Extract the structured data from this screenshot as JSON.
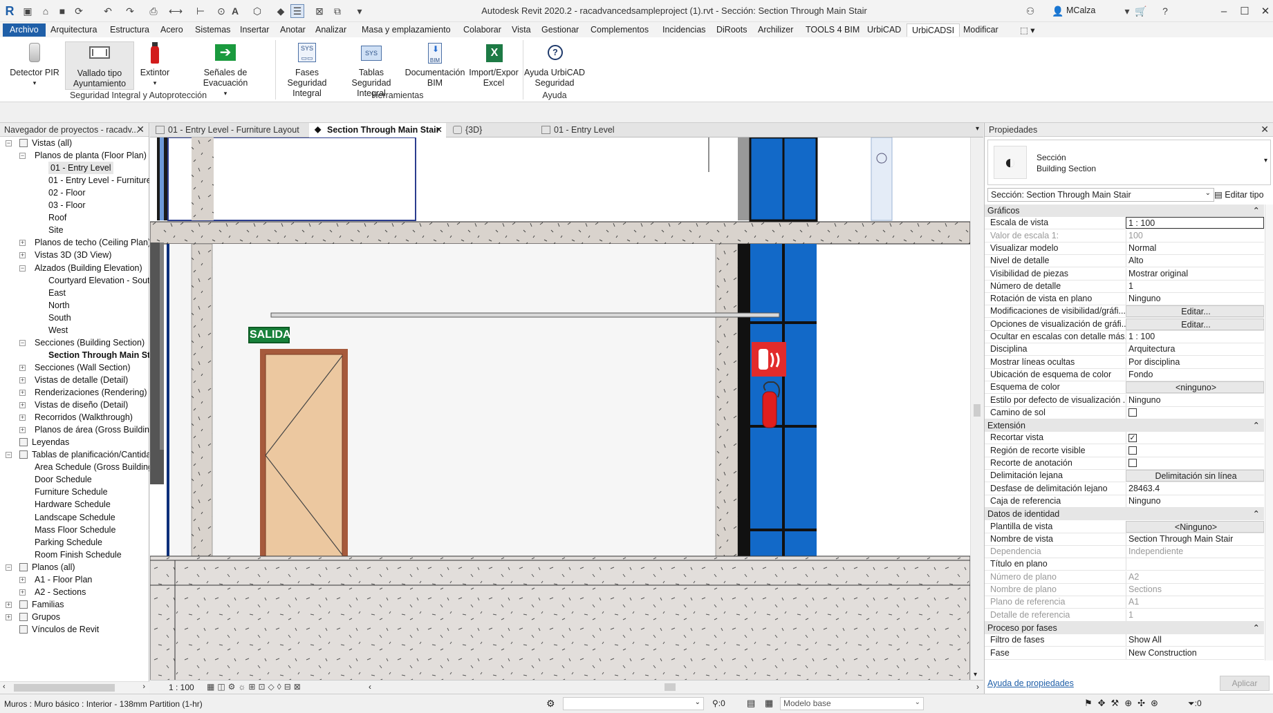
{
  "window": {
    "title": "Autodesk Revit 2020.2 - racadvancedsampleproject (1).rvt - Sección: Section Through Main Stair",
    "user": "MCalza"
  },
  "ribbon": {
    "tabs": [
      "Archivo",
      "Arquitectura",
      "Estructura",
      "Acero",
      "Sistemas",
      "Insertar",
      "Anotar",
      "Analizar",
      "Masa y emplazamiento",
      "Colaborar",
      "Vista",
      "Gestionar",
      "Complementos",
      "Incidencias",
      "DiRoots",
      "Archilizer",
      "TOOLS 4 BIM",
      "UrbiCAD",
      "UrbiCADSI",
      "Modificar"
    ],
    "active_tab": "UrbiCADSI",
    "buttons": [
      {
        "l1": "Detector PIR",
        "l2": ""
      },
      {
        "l1": "Vallado tipo",
        "l2": "Ayuntamiento"
      },
      {
        "l1": "Extintor",
        "l2": ""
      },
      {
        "l1": "Señales de Evacuación",
        "l2": ""
      },
      {
        "l1": "Fases Seguridad",
        "l2": "Integral"
      },
      {
        "l1": "Tablas Seguridad",
        "l2": "Integral"
      },
      {
        "l1": "Documentación",
        "l2": "BIM"
      },
      {
        "l1": "Import/Expor",
        "l2": "Excel"
      },
      {
        "l1": "Ayuda UrbiCAD",
        "l2": "Seguridad"
      }
    ],
    "groups": [
      "Seguridad Integral y Autoprotección",
      "Herramientas",
      "Ayuda"
    ]
  },
  "browser": {
    "title": "Navegador de proyectos - racadv...",
    "items": [
      {
        "t": "Vistas (all)",
        "d": 0,
        "tog": "-"
      },
      {
        "t": "Planos de planta (Floor Plan)",
        "d": 1,
        "tog": "-"
      },
      {
        "t": "01 - Entry Level",
        "d": 2,
        "sel": true
      },
      {
        "t": "01 - Entry Level - Furniture",
        "d": 2
      },
      {
        "t": "02 - Floor",
        "d": 2
      },
      {
        "t": "03 - Floor",
        "d": 2
      },
      {
        "t": "Roof",
        "d": 2
      },
      {
        "t": "Site",
        "d": 2
      },
      {
        "t": "Planos de techo (Ceiling Plan)",
        "d": 1,
        "tog": "+"
      },
      {
        "t": "Vistas 3D (3D View)",
        "d": 1,
        "tog": "+"
      },
      {
        "t": "Alzados (Building Elevation)",
        "d": 1,
        "tog": "-"
      },
      {
        "t": "Courtyard Elevation - South",
        "d": 2
      },
      {
        "t": "East",
        "d": 2
      },
      {
        "t": "North",
        "d": 2
      },
      {
        "t": "South",
        "d": 2
      },
      {
        "t": "West",
        "d": 2
      },
      {
        "t": "Secciones (Building Section)",
        "d": 1,
        "tog": "-"
      },
      {
        "t": "Section Through Main Sta",
        "d": 2,
        "bold": true
      },
      {
        "t": "Secciones (Wall Section)",
        "d": 1,
        "tog": "+"
      },
      {
        "t": "Vistas de detalle (Detail)",
        "d": 1,
        "tog": "+"
      },
      {
        "t": "Renderizaciones (Rendering)",
        "d": 1,
        "tog": "+"
      },
      {
        "t": "Vistas de diseño (Detail)",
        "d": 1,
        "tog": "+"
      },
      {
        "t": "Recorridos (Walkthrough)",
        "d": 1,
        "tog": "+"
      },
      {
        "t": "Planos de área (Gross Building",
        "d": 1,
        "tog": "+"
      },
      {
        "t": "Leyendas",
        "d": 0
      },
      {
        "t": "Tablas de planificación/Cantidad",
        "d": 0,
        "tog": "-"
      },
      {
        "t": "Area Schedule (Gross Building",
        "d": 1
      },
      {
        "t": "Door Schedule",
        "d": 1
      },
      {
        "t": "Furniture Schedule",
        "d": 1
      },
      {
        "t": "Hardware Schedule",
        "d": 1
      },
      {
        "t": "Landscape Schedule",
        "d": 1
      },
      {
        "t": "Mass Floor Schedule",
        "d": 1
      },
      {
        "t": "Parking Schedule",
        "d": 1
      },
      {
        "t": "Room Finish Schedule",
        "d": 1
      },
      {
        "t": "Planos (all)",
        "d": 0,
        "tog": "-"
      },
      {
        "t": "A1 - Floor Plan",
        "d": 1,
        "tog": "+"
      },
      {
        "t": "A2 - Sections",
        "d": 1,
        "tog": "+"
      },
      {
        "t": "Familias",
        "d": 0,
        "tog": "+"
      },
      {
        "t": "Grupos",
        "d": 0,
        "tog": "+"
      },
      {
        "t": "Vínculos de Revit",
        "d": 0
      }
    ]
  },
  "view_tabs": [
    {
      "label": "01 - Entry Level - Furniture Layout",
      "active": false
    },
    {
      "label": "Section Through Main Stair",
      "active": true
    },
    {
      "label": "{3D}",
      "active": false
    },
    {
      "label": "01 - Entry Level",
      "active": false
    }
  ],
  "canvas": {
    "exit_sign": "SALIDA"
  },
  "view_control": {
    "scale": "1 : 100"
  },
  "properties": {
    "title": "Propiedades",
    "family": "Sección",
    "type": "Building Section",
    "selector": "Sección: Section Through Main Stair",
    "edit_type": "Editar tipo",
    "help": "Ayuda de propiedades",
    "apply": "Aplicar",
    "sections": [
      {
        "name": "Gráficos",
        "rows": [
          {
            "k": "Escala de vista",
            "v": "1 : 100",
            "kind": "input"
          },
          {
            "k": "Valor de escala    1:",
            "v": "100",
            "dis": true
          },
          {
            "k": "Visualizar modelo",
            "v": "Normal"
          },
          {
            "k": "Nivel de detalle",
            "v": "Alto"
          },
          {
            "k": "Visibilidad de piezas",
            "v": "Mostrar original"
          },
          {
            "k": "Número de detalle",
            "v": "1"
          },
          {
            "k": "Rotación de vista en plano",
            "v": "Ninguno"
          },
          {
            "k": "Modificaciones de visibilidad/gráfi...",
            "v": "Editar...",
            "kind": "btn"
          },
          {
            "k": "Opciones de visualización de gráfi...",
            "v": "Editar...",
            "kind": "btn"
          },
          {
            "k": "Ocultar en escalas con detalle más...",
            "v": "1 : 100"
          },
          {
            "k": "Disciplina",
            "v": "Arquitectura"
          },
          {
            "k": "Mostrar líneas ocultas",
            "v": "Por disciplina"
          },
          {
            "k": "Ubicación de esquema de color",
            "v": "Fondo"
          },
          {
            "k": "Esquema de color",
            "v": "<ninguno>",
            "kind": "btn"
          },
          {
            "k": "Estilo por defecto de visualización ...",
            "v": "Ninguno"
          },
          {
            "k": "Camino de sol",
            "v": "",
            "kind": "cb",
            "checked": false
          }
        ]
      },
      {
        "name": "Extensión",
        "rows": [
          {
            "k": "Recortar vista",
            "v": "",
            "kind": "cb",
            "checked": true
          },
          {
            "k": "Región de recorte visible",
            "v": "",
            "kind": "cb",
            "checked": false
          },
          {
            "k": "Recorte de anotación",
            "v": "",
            "kind": "cb",
            "checked": false
          },
          {
            "k": "Delimitación lejana",
            "v": "Delimitación sin línea",
            "kind": "btn"
          },
          {
            "k": "Desfase de delimitación lejano",
            "v": "28463.4"
          },
          {
            "k": "Caja de referencia",
            "v": "Ninguno"
          }
        ]
      },
      {
        "name": "Datos de identidad",
        "rows": [
          {
            "k": "Plantilla de vista",
            "v": "<Ninguno>",
            "kind": "btn"
          },
          {
            "k": "Nombre de vista",
            "v": "Section Through Main Stair"
          },
          {
            "k": "Dependencia",
            "v": "Independiente",
            "dis": true
          },
          {
            "k": "Título en plano",
            "v": ""
          },
          {
            "k": "Número de plano",
            "v": "A2",
            "dis": true
          },
          {
            "k": "Nombre de plano",
            "v": "Sections",
            "dis": true
          },
          {
            "k": "Plano de referencia",
            "v": "A1",
            "dis": true
          },
          {
            "k": "Detalle de referencia",
            "v": "1",
            "dis": true
          }
        ]
      },
      {
        "name": "Proceso por fases",
        "rows": [
          {
            "k": "Filtro de fases",
            "v": "Show All"
          },
          {
            "k": "Fase",
            "v": "New Construction"
          }
        ]
      }
    ]
  },
  "status": {
    "text": "Muros : Muro básico : Interior - 138mm Partition (1-hr)",
    "sel_count": ":0",
    "model": "Modelo base",
    "filter_count": ":0"
  }
}
